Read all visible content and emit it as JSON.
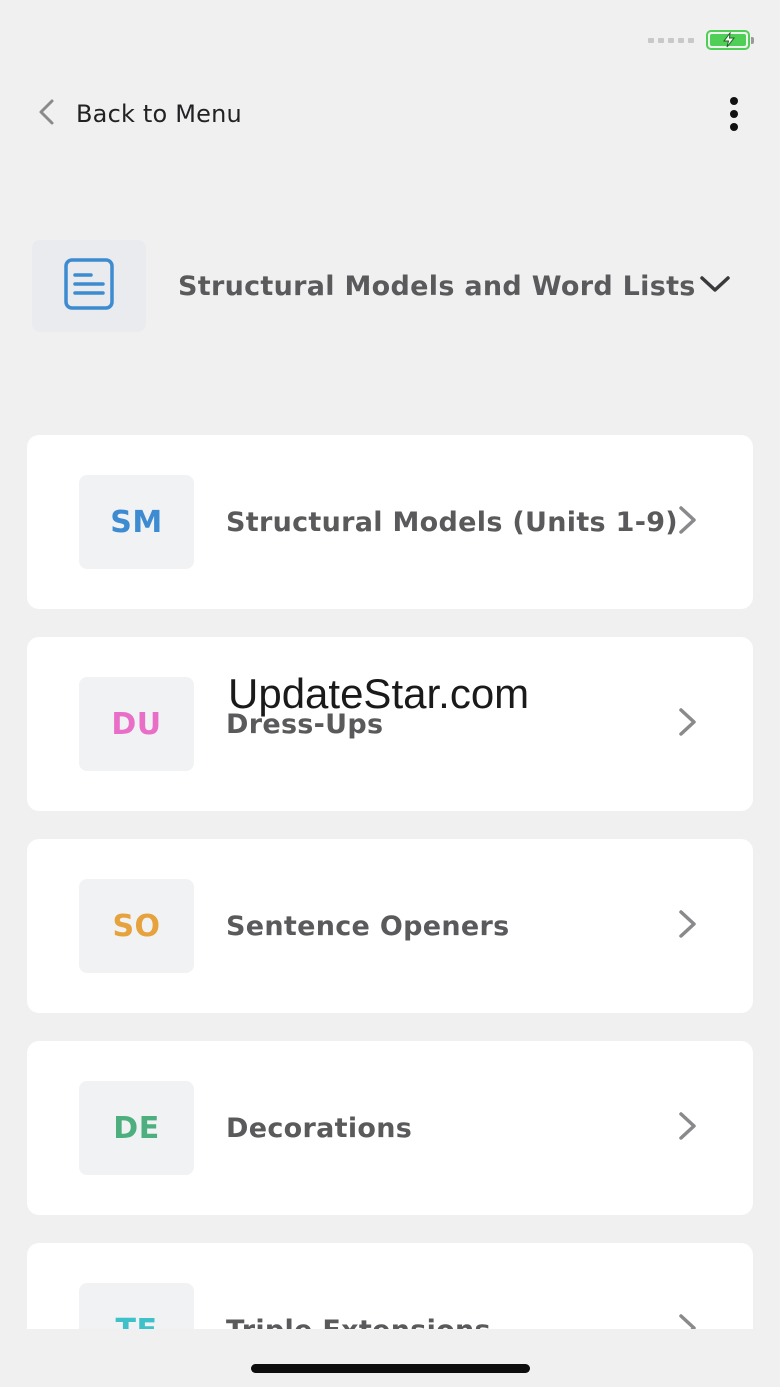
{
  "header": {
    "back_label": "Back to Menu"
  },
  "section": {
    "title": "Structural Models and Word Lists"
  },
  "items": [
    {
      "abbr": "SM",
      "title": "Structural Models (Units 1-9)",
      "color": "#3d8bd1"
    },
    {
      "abbr": "DU",
      "title": "Dress-Ups",
      "color": "#e86ec8"
    },
    {
      "abbr": "SO",
      "title": "Sentence Openers",
      "color": "#e6a23c"
    },
    {
      "abbr": "DE",
      "title": "Decorations",
      "color": "#4caf7d"
    },
    {
      "abbr": "TE",
      "title": "Triple Extensions",
      "color": "#3fc1c9"
    }
  ],
  "watermark": "UpdateStar.com",
  "colors": {
    "background": "#f0f0f1",
    "card": "#ffffff",
    "doc_icon": "#3d8bd1",
    "battery": "#4fcf55"
  },
  "icons": {
    "back": "chevron-left-icon",
    "menu": "more-vertical-icon",
    "section": "document-icon",
    "dropdown": "chevron-down-icon",
    "row": "chevron-right-icon"
  }
}
